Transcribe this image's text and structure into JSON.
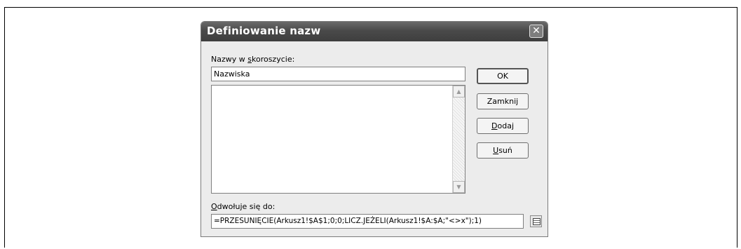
{
  "dialog": {
    "title": "Definiowanie nazw",
    "close_symbol": "✕"
  },
  "names_label": {
    "before": "Nazwy w ",
    "underlined": "s",
    "after": "koroszycie:"
  },
  "name_input_value": "Nazwiska",
  "names_list": [],
  "scroll_up_symbol": "▲",
  "scroll_down_symbol": "▼",
  "buttons": {
    "ok": "OK",
    "close": "Zamknij",
    "add": {
      "underlined": "D",
      "rest": "odaj"
    },
    "delete": {
      "underlined": "U",
      "rest": "suń"
    }
  },
  "refers_label": {
    "underlined": "O",
    "rest": "dwołuje się do:"
  },
  "refers_to_value": "=PRZESUNIĘCIE(Arkusz1!$A$1;0;0;LICZ.JEŻELI(Arkusz1!$A:$A;\"<>x\");1)",
  "icons": {
    "close": "close-icon",
    "refedit": "range-select-icon"
  }
}
